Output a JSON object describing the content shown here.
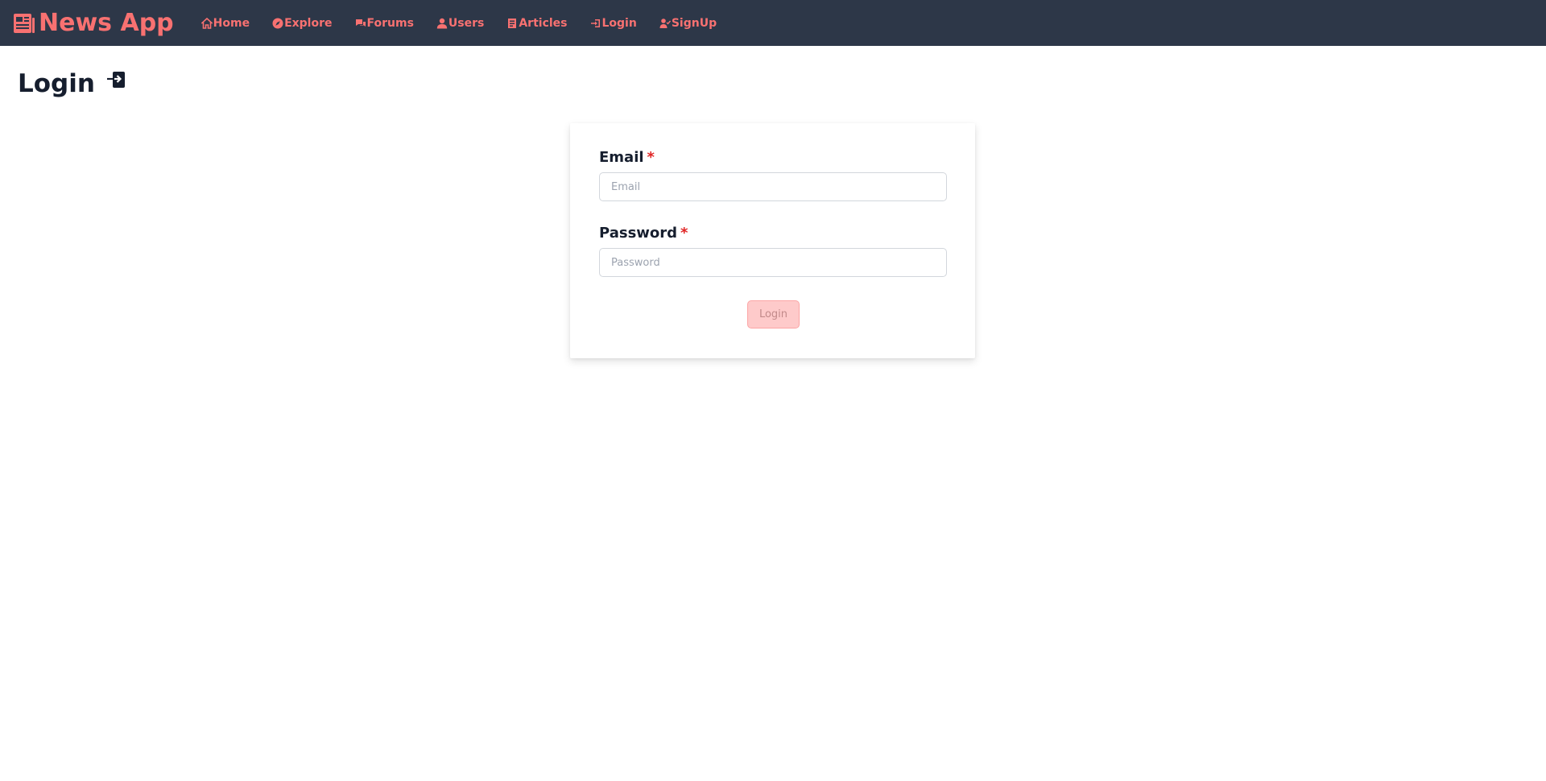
{
  "brand": {
    "name": "News App"
  },
  "nav": {
    "items": [
      {
        "label": "Home",
        "icon": "home-icon"
      },
      {
        "label": "Explore",
        "icon": "compass-icon"
      },
      {
        "label": "Forums",
        "icon": "forum-icon"
      },
      {
        "label": "Users",
        "icon": "user-icon"
      },
      {
        "label": "Articles",
        "icon": "article-icon"
      },
      {
        "label": "Login",
        "icon": "login-icon"
      },
      {
        "label": "SignUp",
        "icon": "user-check-icon"
      }
    ]
  },
  "page": {
    "title": "Login"
  },
  "form": {
    "email": {
      "label": "Email",
      "required_mark": "*",
      "placeholder": "Email",
      "value": ""
    },
    "password": {
      "label": "Password",
      "required_mark": "*",
      "placeholder": "Password",
      "value": ""
    },
    "submit_label": "Login"
  },
  "colors": {
    "navbar_bg": "#2d3748",
    "accent": "#f87171",
    "required": "#e02424",
    "button_bg": "#fecaca"
  }
}
